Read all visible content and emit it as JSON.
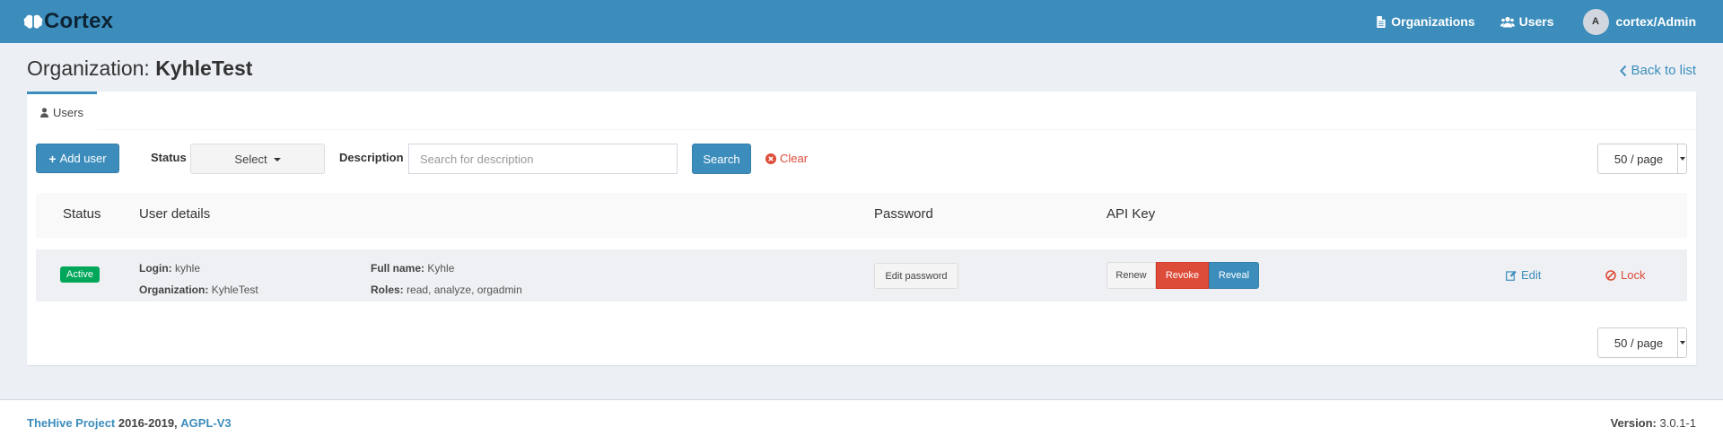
{
  "brand": {
    "name": "Cortex"
  },
  "nav": {
    "organizations_label": "Organizations",
    "users_label": "Users",
    "avatar_initial": "A",
    "user_label": "cortex/Admin"
  },
  "header": {
    "title_prefix": "Organization:",
    "org_name": "KyhleTest",
    "back_label": "Back to list"
  },
  "tabs": [
    {
      "label": "Users",
      "icon": "user-icon"
    }
  ],
  "toolbar": {
    "add_user_label": "Add user",
    "status_label": "Status",
    "status_value": "Select",
    "description_label": "Description",
    "description_placeholder": "Search for description",
    "search_label": "Search",
    "clear_label": "Clear",
    "page_size": "50 / page"
  },
  "table": {
    "columns": [
      "Status",
      "User details",
      "Password",
      "API Key"
    ],
    "rows": [
      {
        "status": "Active",
        "login_label": "Login:",
        "login": "kyhle",
        "organization_label": "Organization:",
        "organization": "KyhleTest",
        "fullname_label": "Full name:",
        "fullname": "Kyhle",
        "roles_label": "Roles:",
        "roles": "read, analyze, orgadmin",
        "edit_password_label": "Edit password",
        "renew_label": "Renew",
        "revoke_label": "Revoke",
        "reveal_label": "Reveal",
        "edit_label": "Edit",
        "lock_label": "Lock"
      }
    ]
  },
  "pagination": {
    "page_size": "50 / page"
  },
  "footer": {
    "project_link": "TheHive Project",
    "years": "2016-2019,",
    "license_link": "AGPL-V3",
    "version_label": "Version:",
    "version": "3.0.1-1"
  },
  "colors": {
    "navbar": "#3c8dbc",
    "primary": "#3c8dbc",
    "danger": "#dd4b39",
    "success": "#00a65a",
    "background": "#ecf0f5"
  }
}
